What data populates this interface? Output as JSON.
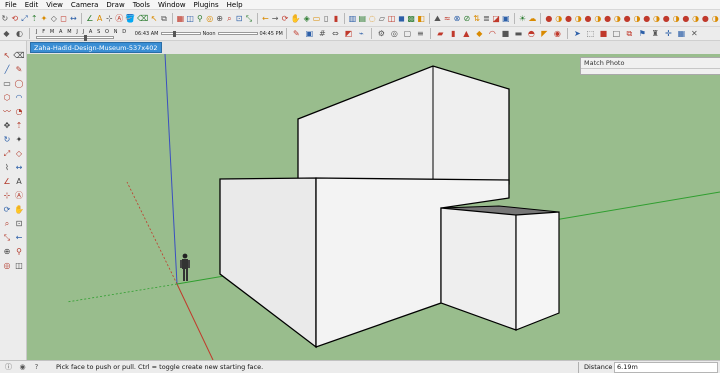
{
  "menu": [
    "File",
    "Edit",
    "View",
    "Camera",
    "Draw",
    "Tools",
    "Window",
    "Plugins",
    "Help"
  ],
  "toolbar1": {
    "icons": [
      "move-icon",
      "rotate-icon",
      "scale-icon",
      "pushpull-icon",
      "followme-icon",
      "offset-icon",
      "tape-icon",
      "dimension-icon",
      "protractor-icon",
      "text-icon",
      "axes-icon",
      "3dtext-icon",
      "paint-icon",
      "eraser-icon",
      "select-icon",
      "component-icon",
      "group-icon",
      "section-icon",
      "walk-icon",
      "lookaround-icon",
      "position-camera-icon",
      "zoom-icon",
      "zoom-window-icon",
      "zoom-extents-icon",
      "prev-view-icon",
      "next-view-icon",
      "orbit-icon",
      "pan-icon",
      "iso-view-icon",
      "top-view-icon",
      "front-view-icon",
      "right-view-icon",
      "back-view-icon",
      "left-view-icon",
      "xray-icon",
      "wireframe-icon",
      "hidden-line-icon",
      "shaded-icon",
      "textured-icon",
      "monochrome-icon",
      "sandbox-icon",
      "smoove-icon",
      "stamp-icon",
      "drape-icon",
      "flip-icon",
      "layer-icon",
      "style-icon",
      "scene-icon",
      "shadow-icon",
      "fog-icon"
    ],
    "right_icons": [
      "sphere-icon",
      "cube-icon",
      "cylinder-icon",
      "cone-icon",
      "torus-icon",
      "plugin-a-icon",
      "plugin-b-icon",
      "plugin-c-icon",
      "plugin-d-icon",
      "plugin-e-icon",
      "plugin-f-icon",
      "plugin-g-icon",
      "plugin-h-icon",
      "plugin-i-icon",
      "plugin-j-icon",
      "plugin-k-icon",
      "plugin-l-icon",
      "plugin-m-icon"
    ]
  },
  "toolbar2": {
    "months": "J F M A M J J A S O N D",
    "time_start": "06:43 AM",
    "time_mid": "Noon",
    "time_end": "04:45 PM",
    "month_level": 0.62,
    "time_level": 0.3
  },
  "scene_tab": "Zaha-Hadid-Design-Museum-537x402",
  "match_photo": {
    "title": "Match Photo"
  },
  "status": {
    "text": "Pick face to push or pull.  Ctrl = toggle create new starting face.",
    "measurement_label": "Distance",
    "measurement_value": "6.19m"
  },
  "colors": {
    "viewport_bg": "#99bd8d",
    "face": "#ececec",
    "edge": "#000000",
    "axis_red": "#c03a2b",
    "axis_green": "#2f9e2f",
    "axis_blue": "#3a4fc0",
    "tab_active": "#3a8ed4"
  }
}
